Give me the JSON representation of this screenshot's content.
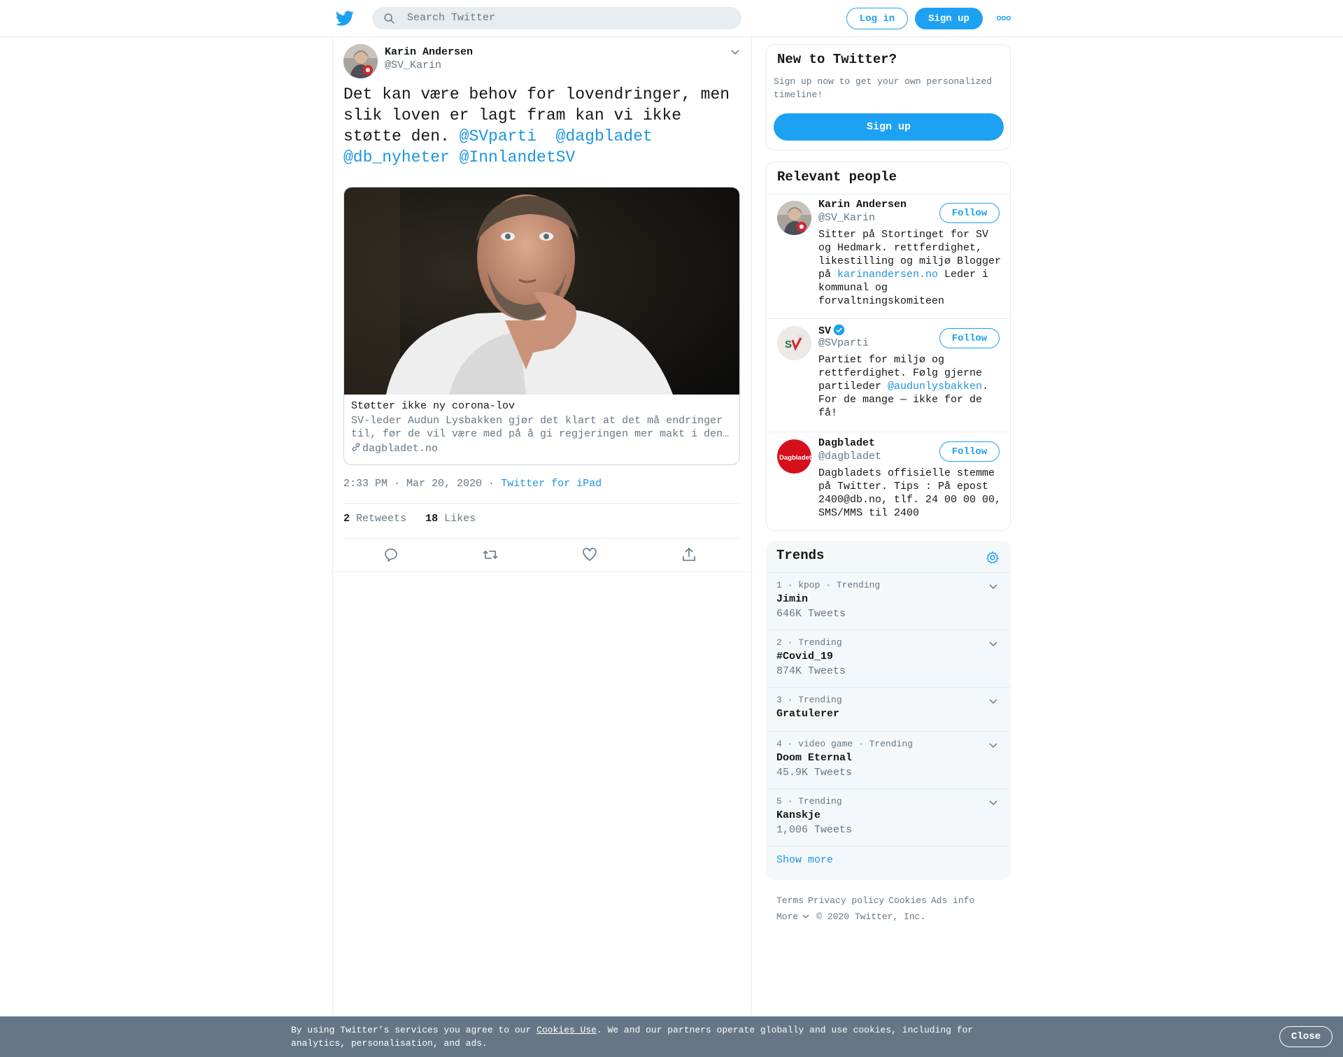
{
  "header": {
    "search_placeholder": "Search Twitter",
    "login_label": "Log in",
    "signup_label": "Sign up"
  },
  "tweet": {
    "author_name": "Karin Andersen",
    "author_handle": "@SV_Karin",
    "text_plain": "Det kan være behov for lovendringer, men slik loven er lagt fram kan vi ikke støtte den. ",
    "mentions": [
      "@SVparti",
      "@dagbladet",
      "@db_nyheter",
      "@InnlandetSV"
    ],
    "card": {
      "title": "Støtter ikke ny corona-lov",
      "description": "SV-leder Audun Lysbakken gjør det klart at det må endringer til, før de vil være med på å gi regjeringen mer makt i den…",
      "domain": "dagbladet.no"
    },
    "time": "2:33 PM · Mar 20, 2020",
    "source": "Twitter for iPad",
    "retweets_count": "2",
    "retweets_label": "Retweets",
    "likes_count": "18",
    "likes_label": "Likes"
  },
  "sidebar": {
    "new_to_twitter": {
      "title": "New to Twitter?",
      "subtitle": "Sign up now to get your own personalized timeline!",
      "button": "Sign up"
    },
    "relevant_people": {
      "title": "Relevant people",
      "follow_label": "Follow",
      "people": [
        {
          "name": "Karin Andersen",
          "handle": "@SV_Karin",
          "bio_before": "Sitter på Stortinget for SV og Hedmark. rettferdighet, likestilling og miljø Blogger på ",
          "bio_link": "karinandersen.no",
          "bio_after": " Leder i kommunal og forvaltningskomiteen"
        },
        {
          "name": "SV",
          "handle": "@SVparti",
          "verified": true,
          "bio_before": "Partiet for miljø og rettferdighet. Følg gjerne partileder ",
          "bio_link": "@audunlysbakken",
          "bio_after": ". For de mange — ikke for de få!"
        },
        {
          "name": "Dagbladet",
          "handle": "@dagbladet",
          "bio_before": "Dagbladets offisielle stemme på Twitter. Tips : På epost 2400@db.no, tlf. 24 00 00 00, SMS/MMS til 2400",
          "bio_link": "",
          "bio_after": ""
        }
      ]
    },
    "trends": {
      "title": "Trends",
      "items": [
        {
          "meta": "1 · kpop · Trending",
          "name": "Jimin",
          "count": "646K Tweets"
        },
        {
          "meta": "2 · Trending",
          "name": "#Covid_19",
          "count": "874K Tweets"
        },
        {
          "meta": "3 · Trending",
          "name": "Gratulerer",
          "count": ""
        },
        {
          "meta": "4 · video game · Trending",
          "name": "Doom Eternal",
          "count": "45.9K Tweets"
        },
        {
          "meta": "5 · Trending",
          "name": "Kanskje",
          "count": "1,006 Tweets"
        }
      ],
      "show_more": "Show more"
    },
    "footer": {
      "links": [
        "Terms",
        "Privacy policy",
        "Cookies",
        "Ads info"
      ],
      "more": "More",
      "copyright": "© 2020 Twitter, Inc."
    }
  },
  "cookie_bar": {
    "text_before": "By using Twitter’s services you agree to our ",
    "link": "Cookies Use",
    "text_after": ". We and our partners operate globally and use cookies, including for analytics, personalisation, and ads.",
    "close_label": "Close"
  },
  "colors": {
    "accent": "#1da1f2",
    "link": "#1b95e0",
    "muted": "#657786",
    "cookie_bg": "#657786"
  }
}
